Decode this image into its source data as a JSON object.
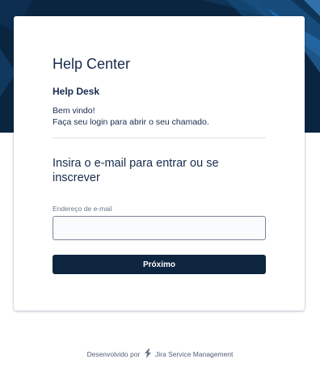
{
  "colors": {
    "hero_background": "#0a2540",
    "accent_blue": "#1f6fd0",
    "button": "#0e2540"
  },
  "header": {
    "title": "Help Center",
    "portal_name": "Help Desk",
    "welcome_line1": "Bem vindo!",
    "welcome_line2": "Faça seu login para abrir o seu chamado."
  },
  "login": {
    "heading": "Insira o e-mail para entrar ou se inscrever",
    "email_label": "Endereço de e-mail",
    "email_value": "",
    "next_label": "Próximo"
  },
  "footer": {
    "powered_by": "Desenvolvido por",
    "product_icon": "jira-service-management-icon",
    "product": "Jira Service Management"
  }
}
